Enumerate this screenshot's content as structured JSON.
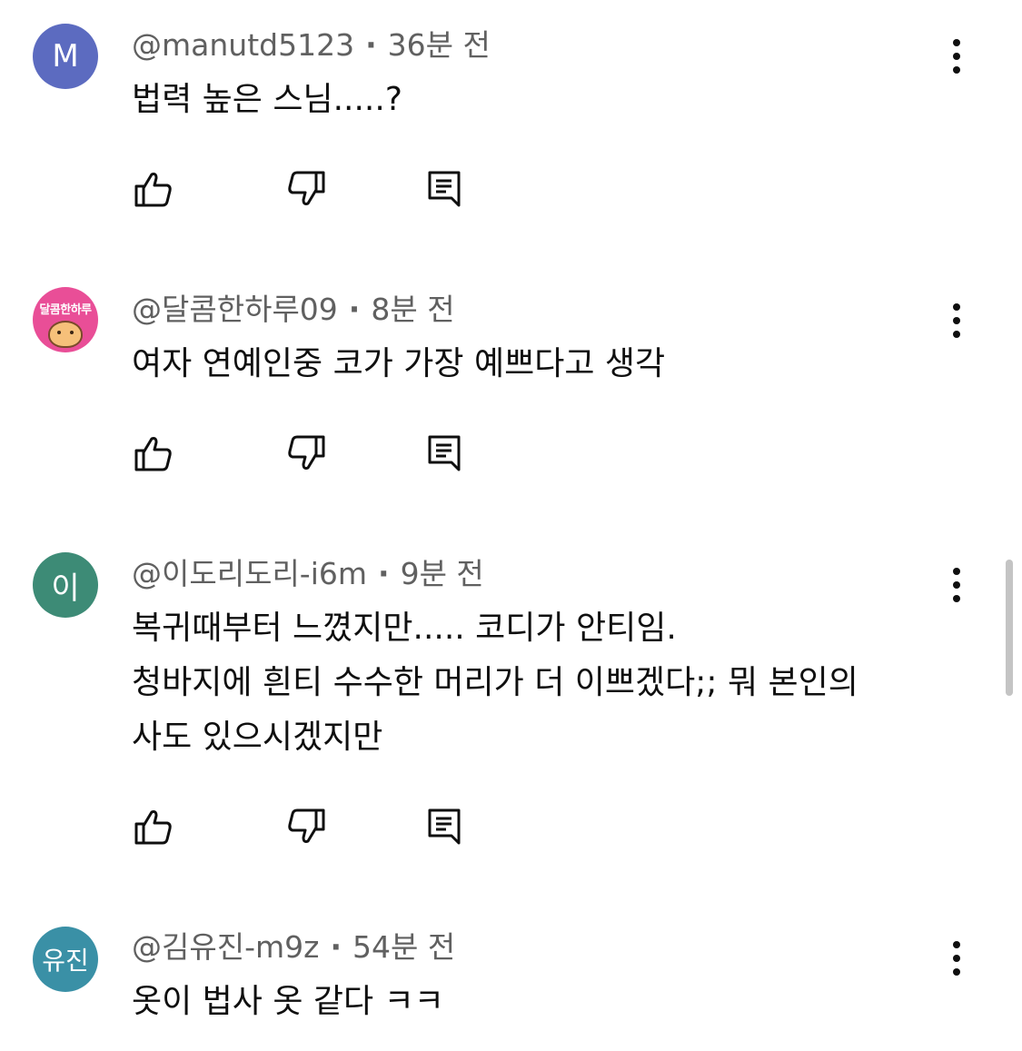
{
  "comments": [
    {
      "avatar": {
        "text": "M",
        "color": "#5c6bc0"
      },
      "handle": "@manutd5123",
      "time": "36분 전",
      "lines": [
        "법력 높은 스님.....?"
      ]
    },
    {
      "avatar": {
        "text": "달콤한하루",
        "color": "#e94e97"
      },
      "handle": "@달콤한하루09",
      "time": "8분 전",
      "lines": [
        "여자 연예인중 코가 가장 예쁘다고 생각"
      ]
    },
    {
      "avatar": {
        "text": "이",
        "color": "#3d8b76"
      },
      "handle": "@이도리도리-i6m",
      "time": "9분 전",
      "lines": [
        "복귀때부터 느꼈지만..... 코디가 안티임.",
        "청바지에 흰티 수수한 머리가 더 이쁘겠다;; 뭐 본인의",
        "사도 있으시겠지만"
      ]
    },
    {
      "avatar": {
        "text": "유진",
        "color": "#3a90a6"
      },
      "handle": "@김유진-m9z",
      "time": "54분 전",
      "lines": [
        "옷이 법사 옷 같다 ㅋㅋ"
      ]
    }
  ],
  "icons": {
    "like": "thumbs-up-icon",
    "dislike": "thumbs-down-icon",
    "reply": "reply-icon",
    "more": "more-vertical-icon"
  },
  "colors": {
    "meta_text": "#606060",
    "body_text": "#0f0f0f",
    "icon": "#0f0f0f"
  }
}
